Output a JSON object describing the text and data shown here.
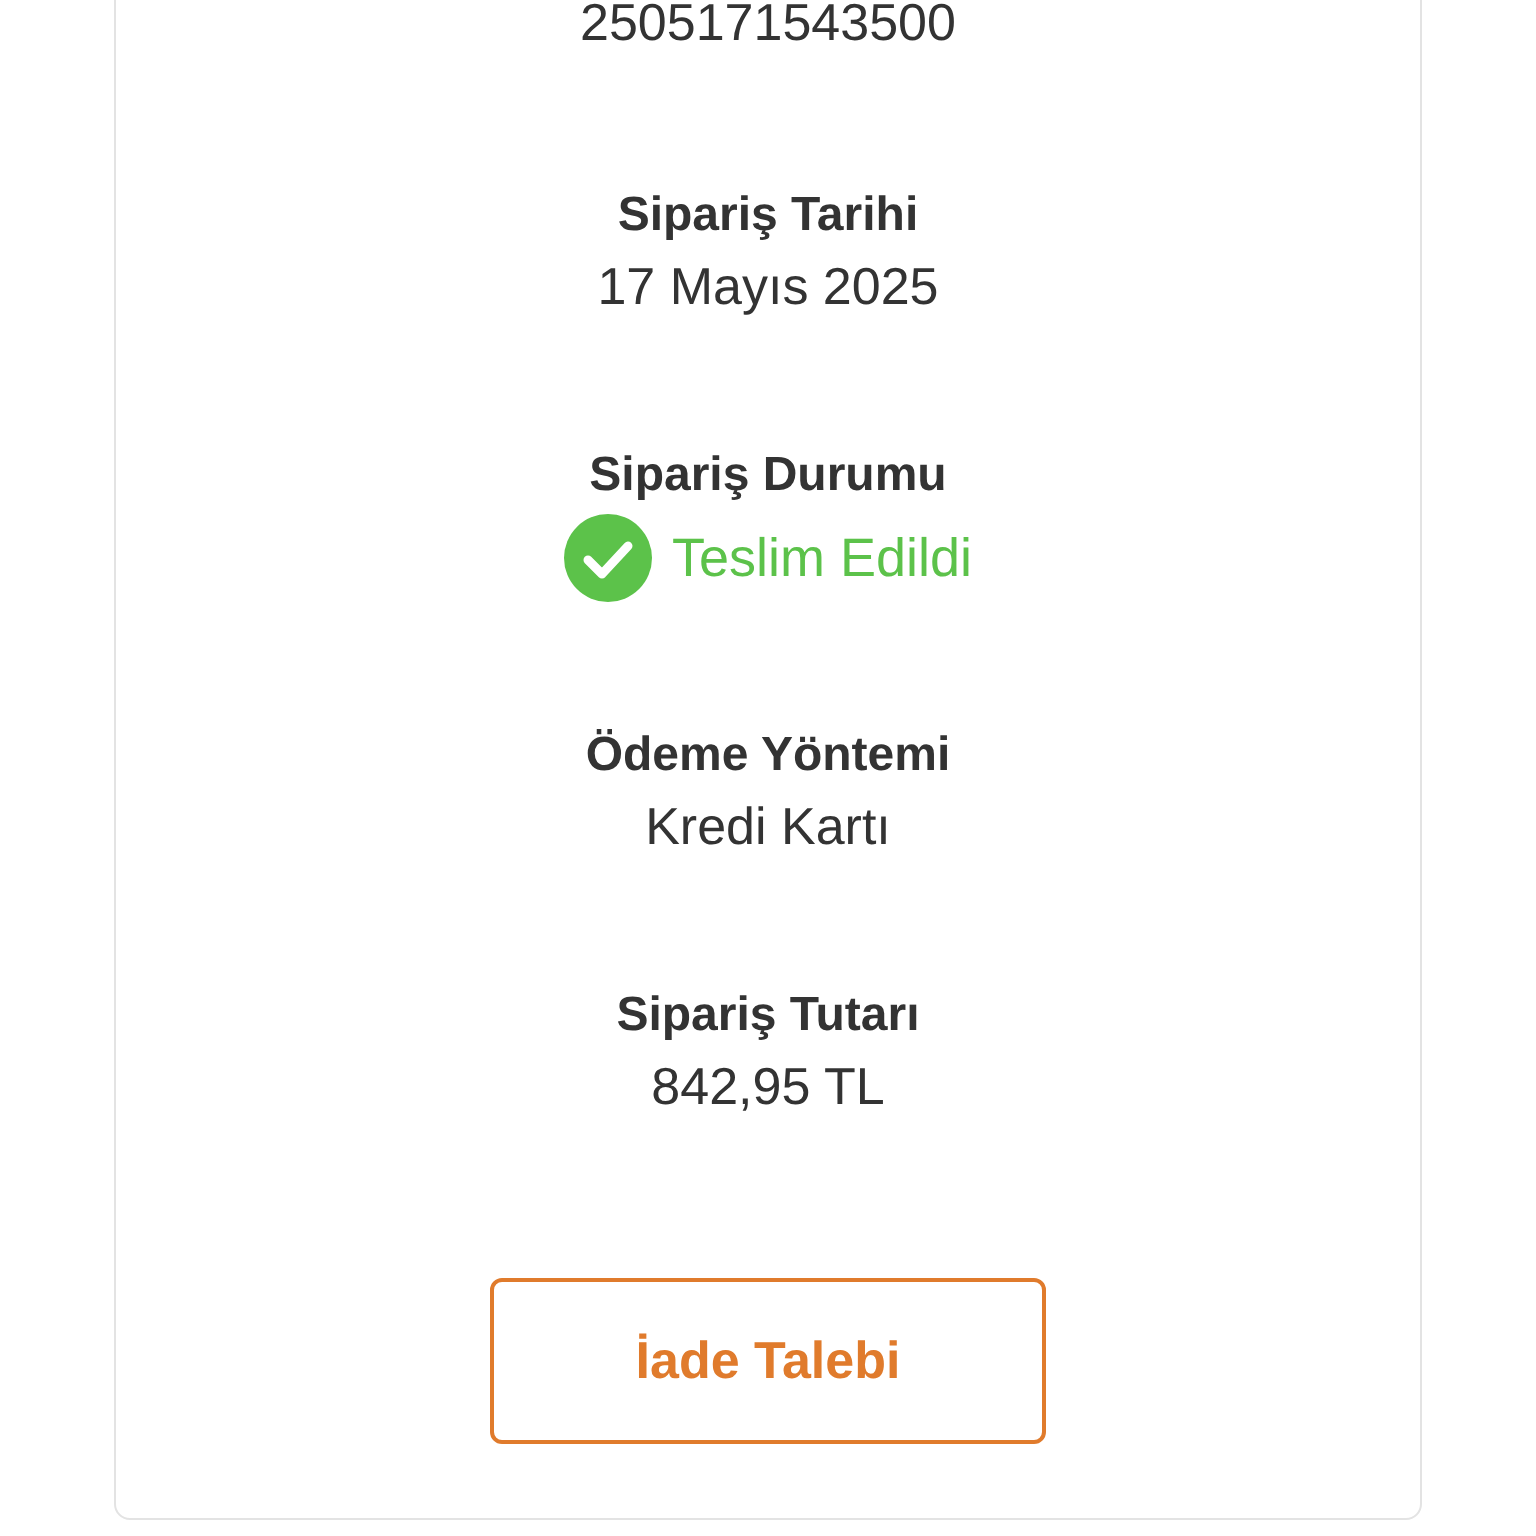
{
  "order_number": {
    "value": "2505171543500"
  },
  "fields": [
    {
      "kind": "text",
      "label": "Sipariş Tarihi",
      "value": "17 Mayıs 2025"
    },
    {
      "kind": "status",
      "label": "Sipariş Durumu",
      "value": "Teslim Edildi",
      "color": "#5cc24a"
    },
    {
      "kind": "text",
      "label": "Ödeme Yöntemi",
      "value": "Kredi Kartı"
    },
    {
      "kind": "text",
      "label": "Sipariş Tutarı",
      "value": "842,95 TL"
    }
  ],
  "button": {
    "label": "İade Talebi"
  }
}
